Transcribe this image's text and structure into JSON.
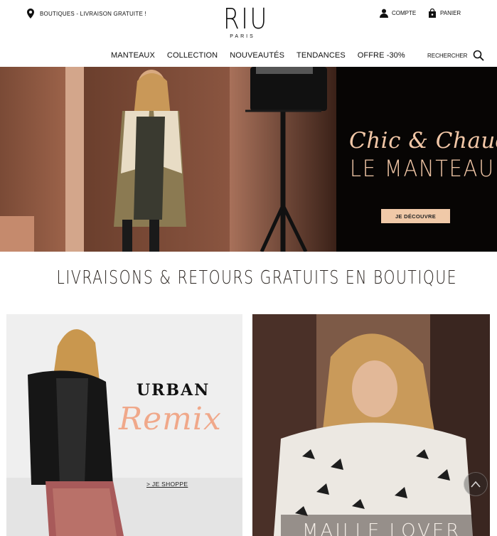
{
  "header": {
    "stores_text": "BOUTIQUES - LIVRAISON GRATUITE !",
    "logo_main": "RIU",
    "logo_sub": "PARIS",
    "account_label": "COMPTE",
    "cart_label": "PANIER",
    "search_label": "RECHERCHER"
  },
  "nav": {
    "items": [
      "MANTEAUX",
      "COLLECTION",
      "NOUVEAUTÉS",
      "TENDANCES",
      "OFFRE -30%"
    ]
  },
  "hero": {
    "title_script": "Chic & Chaud",
    "title_main": "LE MANTEAU",
    "cta": "JE DÉCOUVRE"
  },
  "banner": {
    "text": "LIVRAISONS & RETOURS GRATUITS EN BOUTIQUE"
  },
  "cards": {
    "left": {
      "title": "URBAN",
      "script": "Remix",
      "link": "> JE SHOPPE"
    },
    "right": {
      "title": "MAILLE LOVER"
    }
  },
  "icons": {
    "location": "location-pin-icon",
    "account": "user-icon",
    "cart": "shopping-bag-icon",
    "search": "search-icon",
    "scroll_top": "chevron-up-icon"
  },
  "colors": {
    "accent_peach": "#f0c9a8",
    "remix_pink": "#f0a88a",
    "text_dark": "#111111"
  }
}
